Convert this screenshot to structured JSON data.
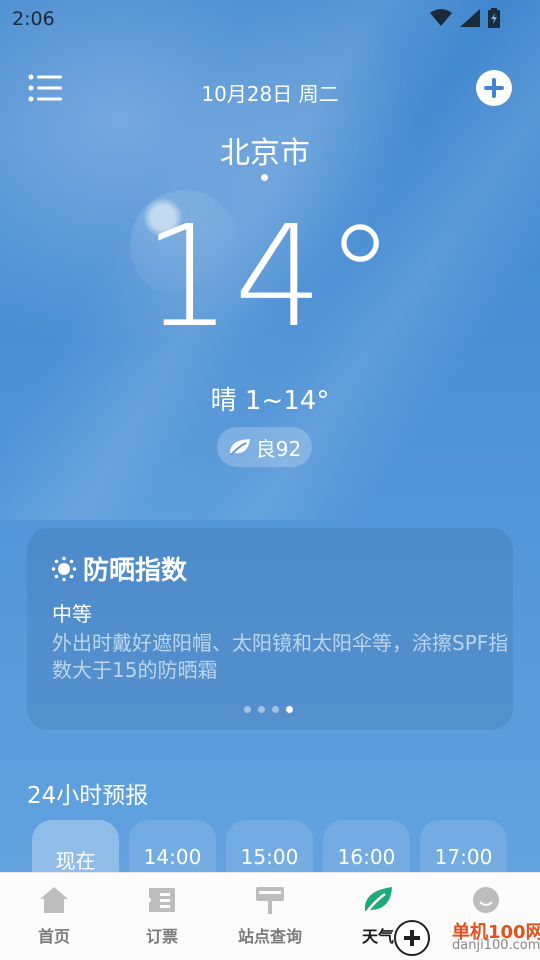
{
  "status_bar": {
    "time": "2:06",
    "icons": [
      "wifi-icon",
      "signal-icon",
      "battery-icon"
    ]
  },
  "header": {
    "date": "10月28日 周二",
    "menu_icon": "list-menu-icon",
    "add_icon": "plus-circle-icon"
  },
  "location": {
    "city": "北京市"
  },
  "current": {
    "temperature": "14°",
    "condition": "晴 1~14°",
    "aqi_label": "良92"
  },
  "index_card": {
    "title": "防晒指数",
    "icon": "sun-icon",
    "level": "中等",
    "description": "外出时戴好遮阳帽、太阳镜和太阳伞等，涂擦SPF指数大于15的防晒霜",
    "pager_total": 4,
    "pager_active": 4
  },
  "hourly": {
    "title": "24小时预报",
    "items": [
      {
        "label": "现在"
      },
      {
        "label": "14:00"
      },
      {
        "label": "15:00"
      },
      {
        "label": "16:00"
      },
      {
        "label": "17:00"
      }
    ]
  },
  "bottom_nav": {
    "items": [
      {
        "label": "首页",
        "icon": "home-icon"
      },
      {
        "label": "订票",
        "icon": "ticket-icon"
      },
      {
        "label": "站点查询",
        "icon": "bus-stop-icon"
      },
      {
        "label": "天气",
        "icon": "leaf-icon",
        "active": true
      },
      {
        "label": "",
        "icon": "smile-icon"
      }
    ]
  },
  "watermark": {
    "brand": "单机100网",
    "url": "danji100.com"
  },
  "colors": {
    "sky_top": "#3f86cf",
    "sky_bottom": "#66a6e0",
    "nav_active_icon": "#1fa878"
  }
}
